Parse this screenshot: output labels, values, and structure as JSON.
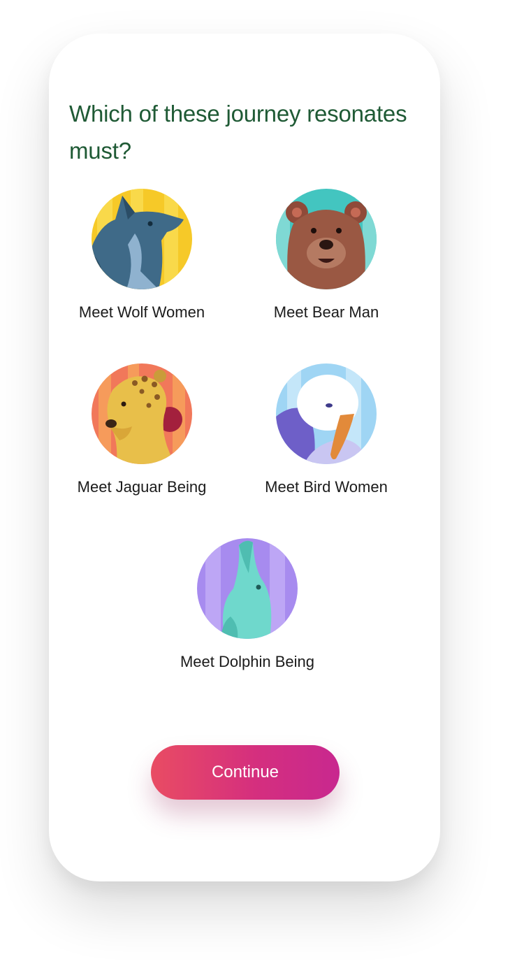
{
  "question": "Which of these journey resonates must?",
  "options": [
    {
      "label": "Meet Wolf Women",
      "icon": "wolf-woman-icon"
    },
    {
      "label": "Meet Bear Man",
      "icon": "bear-man-icon"
    },
    {
      "label": "Meet Jaguar Being",
      "icon": "jaguar-being-icon"
    },
    {
      "label": "Meet Bird Women",
      "icon": "bird-woman-icon"
    },
    {
      "label": "Meet Dolphin Being",
      "icon": "dolphin-being-icon"
    }
  ],
  "continue_label": "Continue",
  "colors": {
    "heading": "#1f5a35",
    "button_start": "#e94c63",
    "button_end": "#c8288f"
  }
}
